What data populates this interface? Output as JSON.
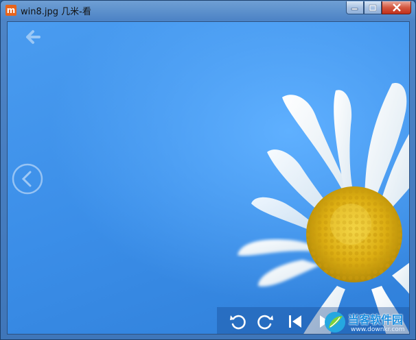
{
  "window": {
    "title": "win8.jpg  几米-看",
    "app_icon_glyph": "m",
    "controls": [
      "minimize-icon",
      "maximize-icon",
      "close-icon"
    ]
  },
  "viewer": {
    "nav_icons": [
      "back-arrow-icon",
      "previous-image-icon"
    ],
    "toolbar_icons": [
      "rotate-left-icon",
      "rotate-right-icon",
      "skip-previous-icon",
      "skip-next-icon"
    ]
  },
  "watermark": {
    "text": "当客软件园",
    "url": "www.downkr.com"
  },
  "colors": {
    "sky": "#3b8ee8",
    "petal": "#f4f8fb",
    "flower_center": "#e6b515",
    "titlebar": "#4d84c6"
  }
}
